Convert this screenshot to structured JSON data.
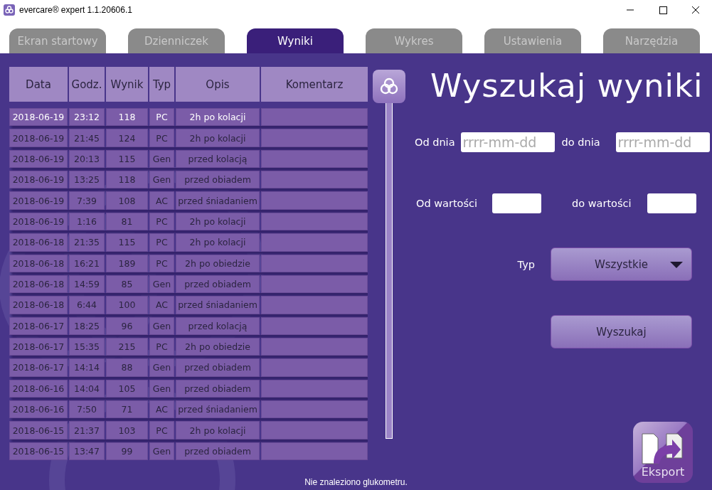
{
  "window": {
    "title": "evercare® expert 1.1.20606.1"
  },
  "tabs": [
    {
      "label": "Ekran startowy",
      "selected": false
    },
    {
      "label": "Dzienniczek",
      "selected": false
    },
    {
      "label": "Wyniki",
      "selected": true
    },
    {
      "label": "Wykres",
      "selected": false
    },
    {
      "label": "Ustawienia",
      "selected": false
    },
    {
      "label": "Narzędzia",
      "selected": false
    }
  ],
  "table": {
    "columns": [
      "Data",
      "Godz.",
      "Wynik",
      "Typ",
      "Opis",
      "Komentarz"
    ],
    "rows": [
      {
        "date": "2018-06-19",
        "time": "23:12",
        "value": "118",
        "type": "PC",
        "description": "2h po kolacji",
        "selected": true
      },
      {
        "date": "2018-06-19",
        "time": "21:45",
        "value": "124",
        "type": "PC",
        "description": "2h po kolacji",
        "selected": false
      },
      {
        "date": "2018-06-19",
        "time": "20:13",
        "value": "115",
        "type": "Gen",
        "description": "przed kolacją",
        "selected": false
      },
      {
        "date": "2018-06-19",
        "time": "13:25",
        "value": "118",
        "type": "Gen",
        "description": "przed obiadem",
        "selected": false
      },
      {
        "date": "2018-06-19",
        "time": "7:39",
        "value": "108",
        "type": "AC",
        "description": "przed śniadaniem",
        "selected": false
      },
      {
        "date": "2018-06-19",
        "time": "1:16",
        "value": "81",
        "type": "PC",
        "description": "2h po kolacji",
        "selected": false
      },
      {
        "date": "2018-06-18",
        "time": "21:35",
        "value": "115",
        "type": "PC",
        "description": "2h po kolacji",
        "selected": false
      },
      {
        "date": "2018-06-18",
        "time": "16:21",
        "value": "189",
        "type": "PC",
        "description": "2h po obiedzie",
        "selected": false
      },
      {
        "date": "2018-06-18",
        "time": "14:59",
        "value": "85",
        "type": "Gen",
        "description": "przed obiadem",
        "selected": false
      },
      {
        "date": "2018-06-18",
        "time": "6:44",
        "value": "100",
        "type": "AC",
        "description": "przed śniadaniem",
        "selected": false
      },
      {
        "date": "2018-06-17",
        "time": "18:25",
        "value": "96",
        "type": "Gen",
        "description": "przed kolacją",
        "selected": false
      },
      {
        "date": "2018-06-17",
        "time": "15:35",
        "value": "215",
        "type": "PC",
        "description": "2h po obiedzie",
        "selected": false
      },
      {
        "date": "2018-06-17",
        "time": "14:14",
        "value": "88",
        "type": "Gen",
        "description": "przed obiadem",
        "selected": false
      },
      {
        "date": "2018-06-16",
        "time": "14:04",
        "value": "105",
        "type": "Gen",
        "description": "przed obiadem",
        "selected": false
      },
      {
        "date": "2018-06-16",
        "time": "7:50",
        "value": "71",
        "type": "AC",
        "description": "przed śniadaniem",
        "selected": false
      },
      {
        "date": "2018-06-15",
        "time": "21:37",
        "value": "103",
        "type": "PC",
        "description": "2h po kolacji",
        "selected": false
      },
      {
        "date": "2018-06-15",
        "time": "13:47",
        "value": "99",
        "type": "Gen",
        "description": "przed obiadem",
        "selected": false
      }
    ]
  },
  "search": {
    "title": "Wyszukaj wyniki",
    "date_from": {
      "label": "Od dnia",
      "placeholder": "rrrr-mm-dd"
    },
    "date_to": {
      "label": "do dnia",
      "placeholder": "rrrr-mm-dd"
    },
    "value_from": {
      "label": "Od wartości"
    },
    "value_to": {
      "label": "do wartości"
    },
    "type_filter": {
      "label": "Typ",
      "value": "Wszystkie"
    },
    "search_button": "Wyszukaj",
    "export_button": "Eksport"
  },
  "status_bar": "Nie znaleziono glukometru."
}
